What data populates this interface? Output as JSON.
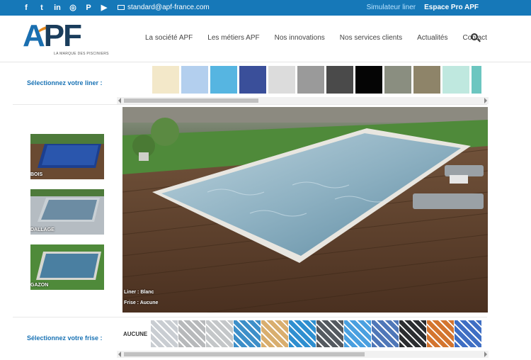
{
  "topbar": {
    "social": [
      {
        "icon": "facebook-icon",
        "glyph": "f"
      },
      {
        "icon": "twitter-icon",
        "glyph": "t"
      },
      {
        "icon": "linkedin-icon",
        "glyph": "in"
      },
      {
        "icon": "instagram-icon",
        "glyph": "◎"
      },
      {
        "icon": "pinterest-icon",
        "glyph": "P"
      },
      {
        "icon": "youtube-icon",
        "glyph": "▶"
      }
    ],
    "email": "standard@apf-france.com",
    "links": {
      "simulator": "Simulateur liner",
      "pro": "Espace Pro APF"
    }
  },
  "logo": {
    "text_a": "A",
    "text_pf": "PF",
    "tagline": "LA MARQUE DES PISCINIERS"
  },
  "nav": [
    "La société APF",
    "Les métiers APF",
    "Nos innovations",
    "Nos services clients",
    "Actualités",
    "Contact"
  ],
  "liner": {
    "label": "Sélectionnez votre liner :",
    "swatches": [
      "#f3e8c9",
      "#b3cfee",
      "#56b5e1",
      "#3a4f9a",
      "#dcdcdc",
      "#9a9a9a",
      "#4a4a4a",
      "#050505",
      "#8a8e80",
      "#8e8469",
      "#bfe8df",
      "#6cc6c0"
    ]
  },
  "environments": [
    {
      "label": "BOIS",
      "water": "#1c3f8f",
      "ground": "#6a4a32"
    },
    {
      "label": "DALLAGE",
      "water": "#6c8ca3",
      "ground": "#b5bcc2"
    },
    {
      "label": "GAZON",
      "water": "#4a7fa1",
      "ground": "#4f8a3a"
    }
  ],
  "preview": {
    "liner_caption": "Liner : Blanc",
    "frise_caption": "Frise : Aucune"
  },
  "frise": {
    "label": "Sélectionnez votre frise :",
    "none_label": "AUCUNE",
    "tiles": [
      "#c9cdd2",
      "#b7b9bb",
      "#c4c7c9",
      "#3d8fc9",
      "#d9ae6e",
      "#2f8fd0",
      "#555a60",
      "#4aa0e0",
      "#4f77b8",
      "#2b2d30",
      "#d4752f",
      "#3f6fc4"
    ]
  }
}
